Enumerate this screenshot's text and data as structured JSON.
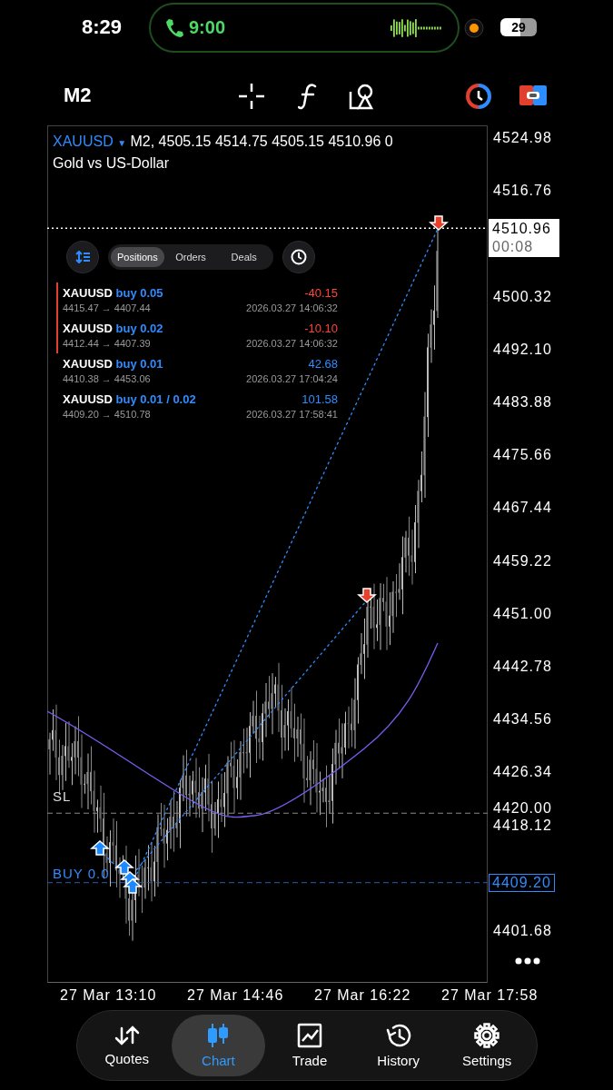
{
  "status_bar": {
    "time": "8:29",
    "call_timer": "9:00",
    "battery": "29"
  },
  "toolbar": {
    "timeframe": "M2"
  },
  "chart": {
    "symbol": "XAUUSD",
    "symbol_menu_marker": "▼",
    "ohlc": "M2, 4505.15 4514.75 4505.15 4510.96 0",
    "description": "Gold vs US-Dollar",
    "price_ticks": [
      "4524.98",
      "4516.76",
      "4500.32",
      "4492.10",
      "4483.88",
      "4475.66",
      "4467.44",
      "4459.22",
      "4451.00",
      "4442.78",
      "4434.56",
      "4426.34",
      "4418.12",
      "4401.68"
    ],
    "current_price": "4510.96",
    "bar_countdown": "00:08",
    "sl_price": "4420.00",
    "sl_label": "SL",
    "entry_price": "4409.20",
    "order_label": "BUY 0.0",
    "time_ticks": [
      "27 Mar 13:10",
      "27 Mar 14:46",
      "27 Mar 16:22",
      "27 Mar 17:58"
    ]
  },
  "trade_panel": {
    "tabs": [
      {
        "label": "Positions",
        "selected": true
      },
      {
        "label": "Orders",
        "selected": false
      },
      {
        "label": "Deals",
        "selected": false
      }
    ],
    "positions": [
      {
        "symbol": "XAUUSD",
        "side": "buy 0.05",
        "prices": "4415.47 → 4407.44",
        "profit": "-40.15",
        "time": "2026.03.27 14:06:32",
        "kind": "loss"
      },
      {
        "symbol": "XAUUSD",
        "side": "buy 0.02",
        "prices": "4412.44 → 4407.39",
        "profit": "-10.10",
        "time": "2026.03.27 14:06:32",
        "kind": "loss"
      },
      {
        "symbol": "XAUUSD",
        "side": "buy 0.01",
        "prices": "4410.38 → 4453.06",
        "profit": "42.68",
        "time": "2026.03.27 17:04:24",
        "kind": "profit"
      },
      {
        "symbol": "XAUUSD",
        "side": "buy 0.01 / 0.02",
        "prices": "4409.20 → 4510.78",
        "profit": "101.58",
        "time": "2026.03.27 17:58:41",
        "kind": "profit"
      }
    ]
  },
  "nav": [
    {
      "label": "Quotes",
      "kind": "quotes",
      "selected": false
    },
    {
      "label": "Chart",
      "kind": "chart",
      "selected": true
    },
    {
      "label": "Trade",
      "kind": "trade",
      "selected": false
    },
    {
      "label": "History",
      "kind": "history",
      "selected": false
    },
    {
      "label": "Settings",
      "kind": "settings",
      "selected": false
    }
  ]
}
